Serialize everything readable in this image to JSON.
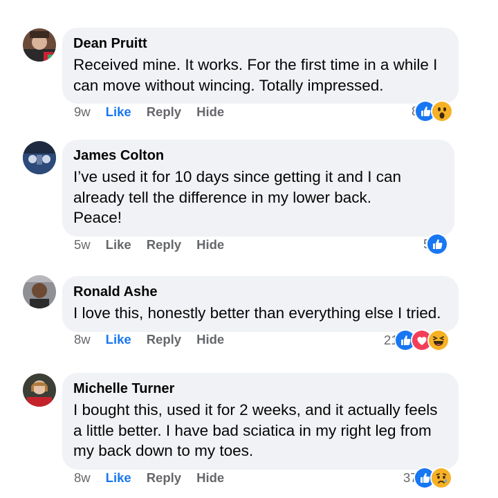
{
  "colors": {
    "bubble": "#f0f2f5",
    "meta_text": "#65676b",
    "like_active": "#1877f2",
    "like_reaction": "#1877f2",
    "love_reaction": "#f33e58",
    "emoji_yellow": "#f7b125"
  },
  "comments": [
    {
      "author": "Dean Pruitt",
      "text": "Received mine. It works. For the first time in a while I can move without wincing. Totally impressed.",
      "time": "9w",
      "like_label": "Like",
      "reply_label": "Reply",
      "hide_label": "Hide",
      "liked": true,
      "reaction_count": "8",
      "reactions": [
        "like-icon",
        "wow-icon"
      ]
    },
    {
      "author": "James Colton",
      "text": "I’ve used it for 10 days since getting it and I can already tell the difference in my lower back. Peace!",
      "time": "5w",
      "like_label": "Like",
      "reply_label": "Reply",
      "hide_label": "Hide",
      "liked": false,
      "reaction_count": "5",
      "reactions": [
        "like-icon"
      ]
    },
    {
      "author": "Ronald Ashe",
      "text": "I love this, honestly better than everything else I tried.",
      "time": "8w",
      "like_label": "Like",
      "reply_label": "Reply",
      "hide_label": "Hide",
      "liked": true,
      "reaction_count": "21",
      "reactions": [
        "like-icon",
        "love-icon",
        "haha-icon"
      ]
    },
    {
      "author": "Michelle Turner",
      "text": "I bought this, used it for 2 weeks, and it actually feels a little better. I have bad sciatica in my right leg from my back down to my toes.",
      "time": "8w",
      "like_label": "Like",
      "reply_label": "Reply",
      "hide_label": "Hide",
      "liked": true,
      "reaction_count": "37",
      "reactions": [
        "like-icon",
        "sad-icon"
      ]
    }
  ]
}
